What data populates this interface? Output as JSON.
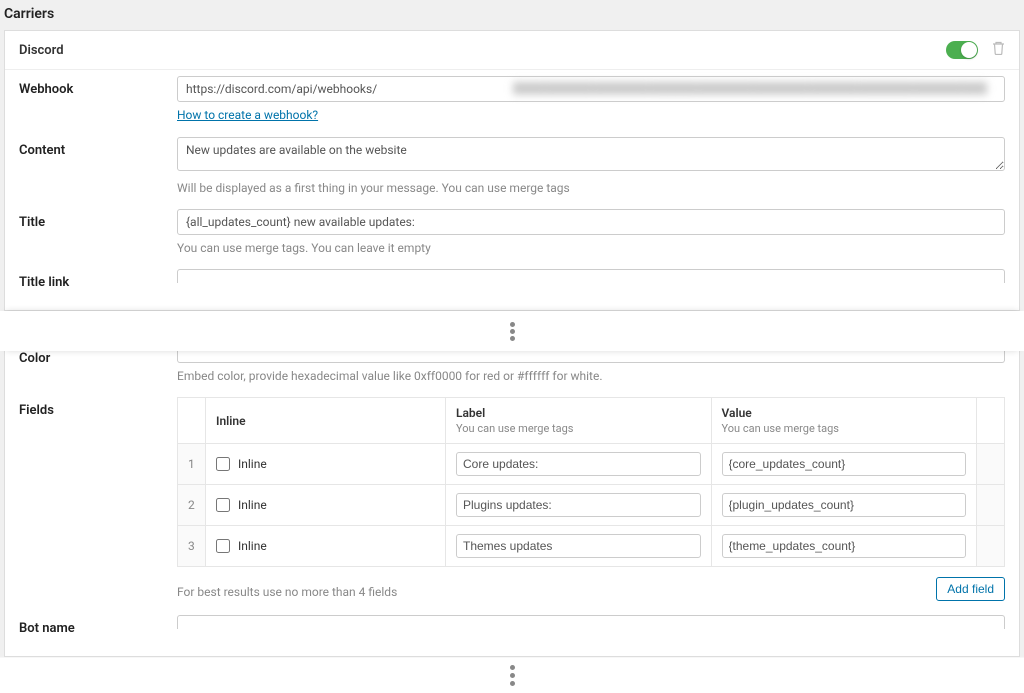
{
  "page_title": "Carriers",
  "carrier_name": "Discord",
  "webhook": {
    "label": "Webhook",
    "value": "https://discord.com/api/webhooks/",
    "help_link": "How to create a webhook?"
  },
  "content": {
    "label": "Content",
    "value": "New updates are available on the website",
    "helper": "Will be displayed as a first thing in your message. You can use merge tags"
  },
  "title": {
    "label": "Title",
    "value": "{all_updates_count} new available updates:",
    "helper": "You can use merge tags. You can leave it empty"
  },
  "title_link": {
    "label": "Title link"
  },
  "color": {
    "label": "Color",
    "helper": "Embed color, provide hexadecimal value like 0xff0000 for red or #ffffff for white."
  },
  "fields": {
    "label": "Fields",
    "columns": {
      "inline": "Inline",
      "label": "Label",
      "label_sub": "You can use merge tags",
      "value": "Value",
      "value_sub": "You can use merge tags"
    },
    "rows": [
      {
        "idx": "1",
        "inline_label": "Inline",
        "label_val": "Core updates:",
        "value_val": "{core_updates_count}"
      },
      {
        "idx": "2",
        "inline_label": "Inline",
        "label_val": "Plugins updates:",
        "value_val": "{plugin_updates_count}"
      },
      {
        "idx": "3",
        "inline_label": "Inline",
        "label_val": "Themes updates",
        "value_val": "{theme_updates_count}"
      }
    ],
    "footer_helper": "For best results use no more than 4 fields",
    "add_button": "Add field"
  },
  "bot_name": {
    "label": "Bot name"
  }
}
